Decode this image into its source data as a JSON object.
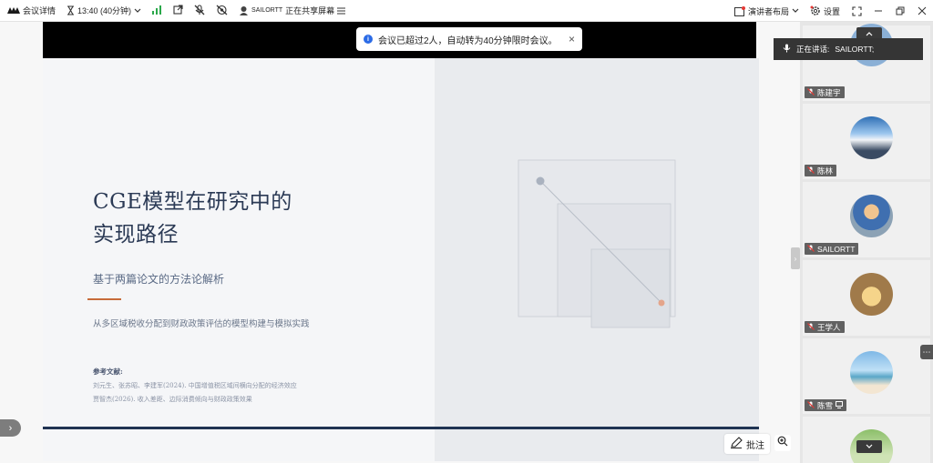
{
  "topbar": {
    "meeting_details": "会议详情",
    "timer": "13:40 (40分钟)",
    "sharer_name": "SAILORTT",
    "sharing_status": "正在共享屏幕",
    "layout_label": "演讲者布局",
    "settings_label": "设置"
  },
  "notice": {
    "text": "会议已超过2人，自动转为40分钟限时会议。"
  },
  "slide": {
    "title_line1": "CGE模型在研究中的",
    "title_line2": "实现路径",
    "subtitle": "基于两篇论文的方法论解析",
    "description": "从多区域税收分配到财政政策评估的模型构建与模拟实践",
    "refs_heading": "参考文献:",
    "ref1": "刘元生、张苏昭、李建军(2024). 中国增值税区域间横向分配的经济效应",
    "ref2": "贾智杰(2026). 收入差距、边际消费倾向与财政政策效果"
  },
  "toolbar": {
    "annotate_label": "批注"
  },
  "panel": {
    "speaking_label": "正在讲话:",
    "speaking_name": "SAILORTT;",
    "participants": [
      {
        "name": "陈建宇"
      },
      {
        "name": "陈林"
      },
      {
        "name": "SAILORTT"
      },
      {
        "name": "王学人"
      },
      {
        "name": "陈雪"
      }
    ]
  },
  "colors": {
    "slide_title": "#2b3a55",
    "accent": "#c76b3a",
    "info_blue": "#2b6be6"
  },
  "icons": [
    "meeting-logo-icon",
    "hourglass-icon",
    "chevron-down-icon",
    "signal-icon",
    "popout-icon",
    "mic-off-icon",
    "camera-off-icon",
    "share-icon",
    "layout-icon",
    "gear-icon",
    "fullscreen-icon",
    "minimize-icon",
    "restore-icon",
    "close-icon",
    "info-icon",
    "pen-icon",
    "zoom-icon"
  ]
}
